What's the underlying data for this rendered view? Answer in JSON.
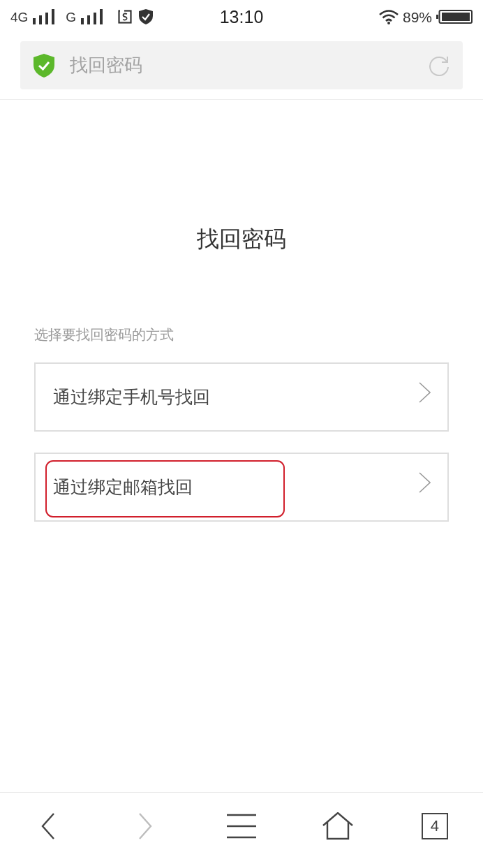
{
  "status_bar": {
    "network_primary": "4G",
    "network_secondary": "G",
    "time": "13:10",
    "battery": "89%"
  },
  "address_bar": {
    "title": "找回密码"
  },
  "page": {
    "title": "找回密码",
    "prompt": "选择要找回密码的方式",
    "options": [
      {
        "label": "通过绑定手机号找回",
        "highlighted": false
      },
      {
        "label": "通过绑定邮箱找回",
        "highlighted": true
      }
    ]
  },
  "toolbar": {
    "buttons": [
      {
        "kind": "back",
        "disabled": false
      },
      {
        "kind": "forward",
        "disabled": true
      },
      {
        "kind": "menu",
        "disabled": false
      },
      {
        "kind": "home",
        "disabled": false
      },
      {
        "kind": "tabs",
        "disabled": false,
        "count": "4"
      }
    ]
  }
}
